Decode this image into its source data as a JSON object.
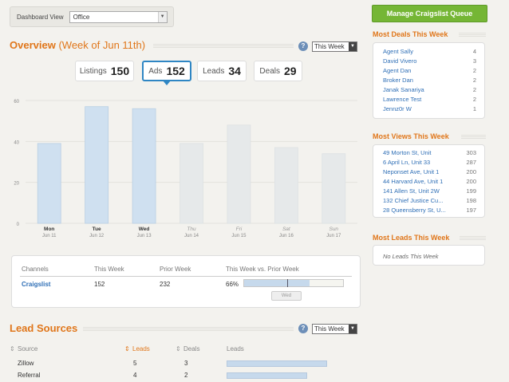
{
  "header": {
    "dashboard_view_label": "Dashboard View",
    "dashboard_view_value": "Office",
    "manage_button": "Manage Craigslist Queue"
  },
  "overview": {
    "title": "Overview",
    "subtitle": "(Week of Jun 11th)",
    "help": "?",
    "period_select": "This Week",
    "tabs": [
      {
        "label": "Listings",
        "value": "150"
      },
      {
        "label": "Ads",
        "value": "152"
      },
      {
        "label": "Leads",
        "value": "34"
      },
      {
        "label": "Deals",
        "value": "29"
      }
    ]
  },
  "chart_data": {
    "type": "bar",
    "categories": [
      "Mon",
      "Tue",
      "Wed",
      "Thu",
      "Fri",
      "Sat",
      "Sun"
    ],
    "dates": [
      "Jun 11",
      "Jun 12",
      "Jun 13",
      "Jun 14",
      "Jun 15",
      "Jun 16",
      "Jun 17"
    ],
    "values": [
      39,
      57,
      56,
      39,
      48,
      37,
      34
    ],
    "future": [
      false,
      false,
      false,
      true,
      true,
      true,
      true
    ],
    "yticks": [
      0,
      20,
      40,
      60
    ],
    "ylim": [
      0,
      60
    ],
    "grid": true,
    "colors": {
      "past": "#cfe0f0",
      "future": "#e6e9ea",
      "past_edge": "#b9cfe4"
    }
  },
  "channels": {
    "headers": [
      "Channels",
      "This Week",
      "Prior Week",
      "This Week vs. Prior Week"
    ],
    "rows": [
      {
        "channel": "Craigslist",
        "this_week": "152",
        "prior_week": "232",
        "pct": "66%",
        "pct_value": 0.66
      }
    ],
    "button": "Wed"
  },
  "lead_sources": {
    "title": "Lead Sources",
    "help": "?",
    "period_select": "This Week",
    "headers": [
      "Source",
      "Leads",
      "Deals",
      "Leads"
    ],
    "rows": [
      {
        "source": "Zillow",
        "leads": "5",
        "deals": "3",
        "bar_fraction": 1.0
      },
      {
        "source": "Referral",
        "leads": "4",
        "deals": "2",
        "bar_fraction": 0.8
      }
    ]
  },
  "most_deals": {
    "title": "Most Deals This Week",
    "items": [
      {
        "name": "Agent Sally",
        "count": "4"
      },
      {
        "name": "David Vivero",
        "count": "3"
      },
      {
        "name": "Agent Dan",
        "count": "2"
      },
      {
        "name": "Broker Dan",
        "count": "2"
      },
      {
        "name": "Janak Sanariya",
        "count": "2"
      },
      {
        "name": "Lawrence Test",
        "count": "2"
      },
      {
        "name": "Jennz0r W",
        "count": "1"
      }
    ]
  },
  "most_views": {
    "title": "Most Views This Week",
    "items": [
      {
        "name": "49 Morton St, Unit",
        "count": "303"
      },
      {
        "name": "6 April Ln, Unit 33",
        "count": "287"
      },
      {
        "name": "Neponset Ave, Unit 1",
        "count": "200"
      },
      {
        "name": "44 Harvard Ave, Unit 1",
        "count": "200"
      },
      {
        "name": "141 Allen St, Unit 2W",
        "count": "199"
      },
      {
        "name": "132 Chief Justice Cu...",
        "count": "198"
      },
      {
        "name": "28 Queensberry St, U...",
        "count": "197"
      }
    ]
  },
  "most_leads": {
    "title": "Most Leads This Week",
    "empty": "No Leads This Week"
  }
}
